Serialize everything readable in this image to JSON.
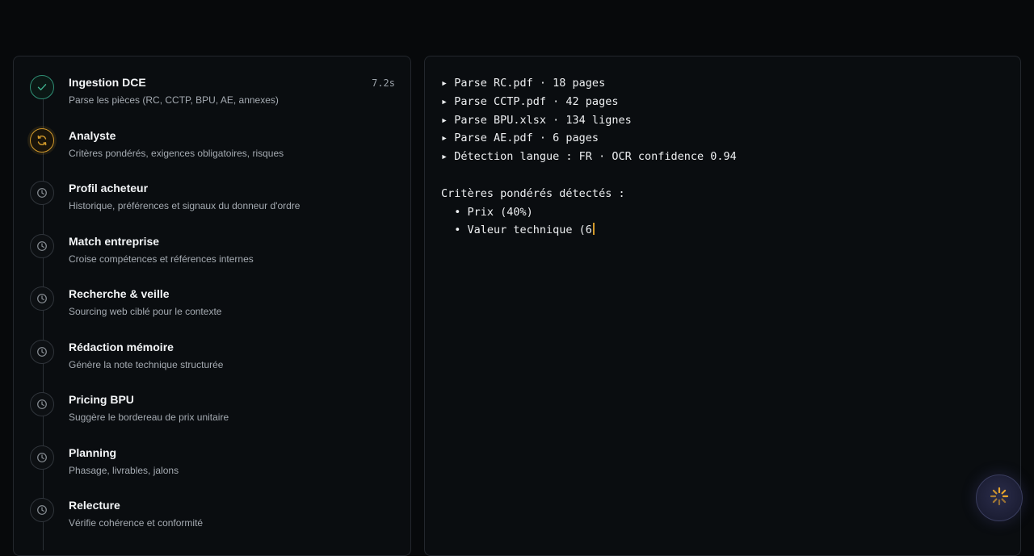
{
  "steps": [
    {
      "title": "Ingestion DCE",
      "desc": "Parse les pièces (RC, CCTP, BPU, AE, annexes)",
      "time": "7.2s",
      "status": "done",
      "icon": "check-icon"
    },
    {
      "title": "Analyste",
      "desc": "Critères pondérés, exigences obligatoires, risques",
      "time": "",
      "status": "active",
      "icon": "refresh-icon"
    },
    {
      "title": "Profil acheteur",
      "desc": "Historique, préférences et signaux du donneur d'ordre",
      "time": "",
      "status": "pending",
      "icon": "clock-icon"
    },
    {
      "title": "Match entreprise",
      "desc": "Croise compétences et références internes",
      "time": "",
      "status": "pending",
      "icon": "clock-icon"
    },
    {
      "title": "Recherche & veille",
      "desc": "Sourcing web ciblé pour le contexte",
      "time": "",
      "status": "pending",
      "icon": "clock-icon"
    },
    {
      "title": "Rédaction mémoire",
      "desc": "Génère la note technique structurée",
      "time": "",
      "status": "pending",
      "icon": "clock-icon"
    },
    {
      "title": "Pricing BPU",
      "desc": "Suggère le bordereau de prix unitaire",
      "time": "",
      "status": "pending",
      "icon": "clock-icon"
    },
    {
      "title": "Planning",
      "desc": "Phasage, livrables, jalons",
      "time": "",
      "status": "pending",
      "icon": "clock-icon"
    },
    {
      "title": "Relecture",
      "desc": "Vérifie cohérence et conformité",
      "time": "",
      "status": "pending",
      "icon": "clock-icon"
    }
  ],
  "log": {
    "lines": [
      "▸ Parse RC.pdf · 18 pages",
      "▸ Parse CCTP.pdf · 42 pages",
      "▸ Parse BPU.xlsx · 134 lignes",
      "▸ Parse AE.pdf · 6 pages",
      "▸ Détection langue : FR · OCR confidence 0.94",
      "",
      "Critères pondérés détectés :",
      "  • Prix (40%)",
      "  • Valeur technique (6"
    ]
  },
  "colors": {
    "done": "#2f8f75",
    "active": "#d39a2b",
    "pending": "#8b9197"
  },
  "fab": {
    "icon": "spinner-icon"
  }
}
